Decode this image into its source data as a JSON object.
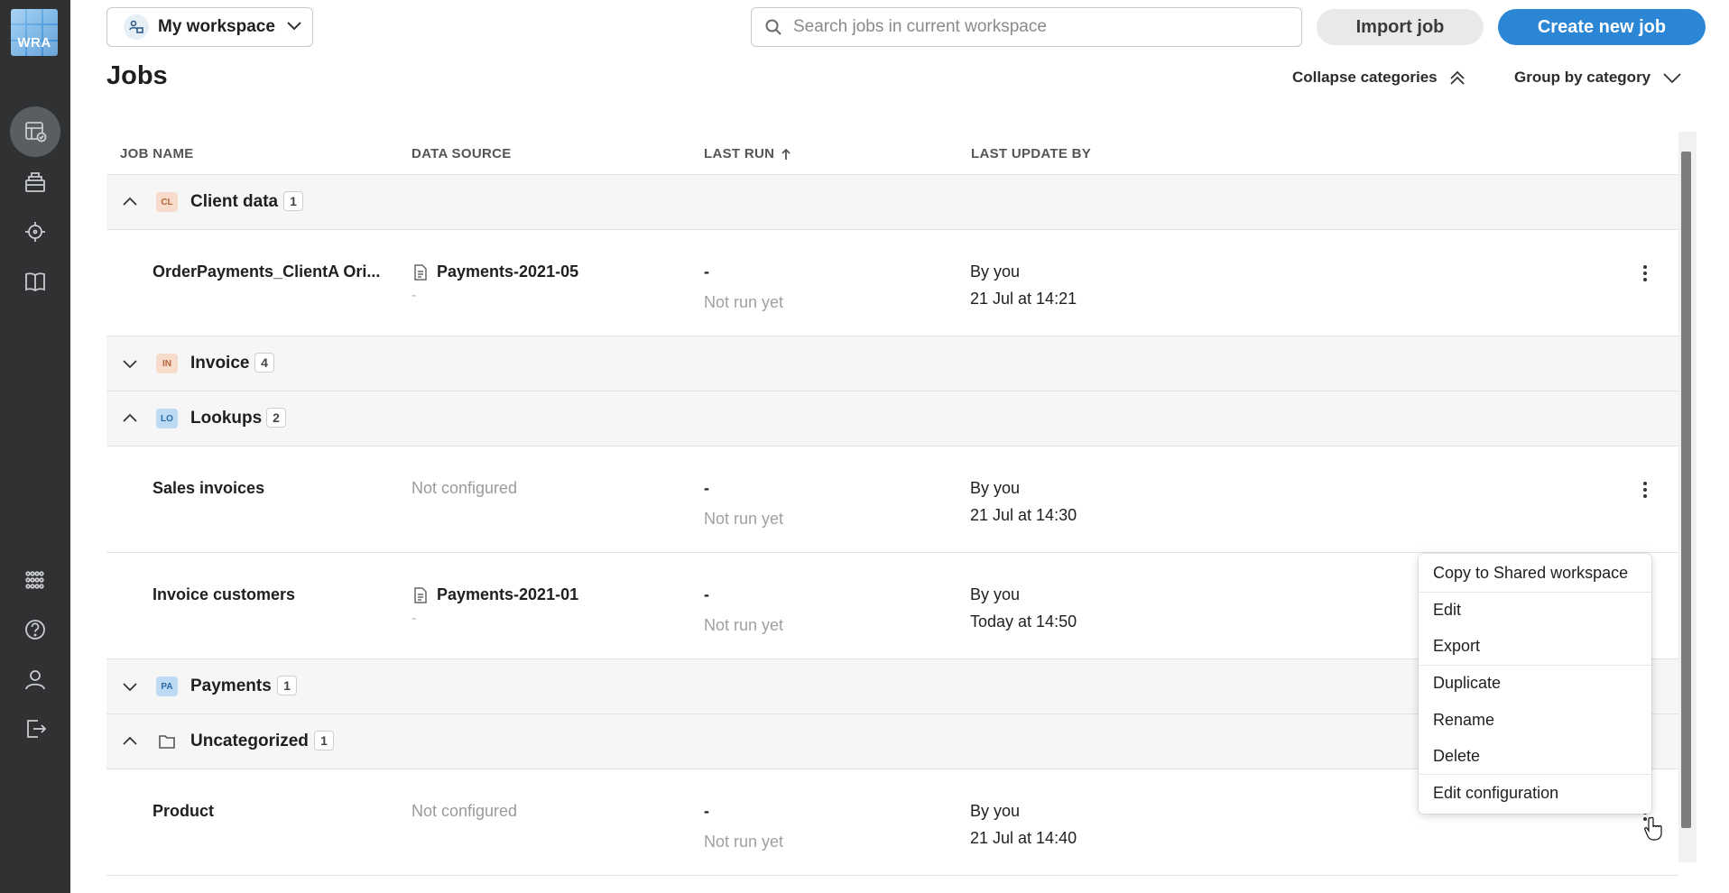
{
  "sidebar": {
    "logo_text": "WRA",
    "items": [
      {
        "name": "jobs-icon",
        "active": true
      },
      {
        "name": "data-sources-icon",
        "active": false
      },
      {
        "name": "target-icon",
        "active": false
      },
      {
        "name": "library-icon",
        "active": false
      },
      {
        "name": "apps-grid-icon",
        "active": false
      },
      {
        "name": "help-icon",
        "active": false
      },
      {
        "name": "user-icon",
        "active": false
      },
      {
        "name": "logout-icon",
        "active": false
      }
    ]
  },
  "header": {
    "workspace_label": "My workspace",
    "search_placeholder": "Search jobs in current workspace",
    "import_label": "Import job",
    "create_label": "Create new job",
    "accent_color": "#2b86d6"
  },
  "page": {
    "title": "Jobs",
    "collapse_label": "Collapse categories",
    "group_by_label": "Group by category"
  },
  "table": {
    "columns": [
      "JOB NAME",
      "DATA SOURCE",
      "LAST RUN",
      "LAST UPDATE BY"
    ],
    "categories": [
      {
        "badge": "CL",
        "name": "Client data",
        "count": "1",
        "expanded": true,
        "badge_bg": "#f7dccc",
        "badge_fg": "#b5643a",
        "jobs": [
          {
            "name": "OrderPayments_ClientA Ori...",
            "source": "Payments-2021-05",
            "source_sub": "-",
            "last_run": "-",
            "last_run_sub": "Not run yet",
            "updated_by": "By you",
            "updated_at": "21 Jul at 14:21"
          }
        ]
      },
      {
        "badge": "IN",
        "name": "Invoice",
        "count": "4",
        "expanded": false,
        "badge_bg": "#f7dccc",
        "badge_fg": "#b5643a",
        "jobs": []
      },
      {
        "badge": "LO",
        "name": "Lookups",
        "count": "2",
        "expanded": true,
        "badge_bg": "#bcdaf3",
        "badge_fg": "#2a6aa3",
        "jobs": [
          {
            "name": "Sales invoices",
            "source": "Not configured",
            "source_sub": "",
            "last_run": "-",
            "last_run_sub": "Not run yet",
            "updated_by": "By you",
            "updated_at": "21 Jul at 14:30"
          },
          {
            "name": "Invoice customers",
            "source": "Payments-2021-01",
            "source_sub": "-",
            "last_run": "-",
            "last_run_sub": "Not run yet",
            "updated_by": "By you",
            "updated_at": "Today at 14:50"
          }
        ]
      },
      {
        "badge": "PA",
        "name": "Payments",
        "count": "1",
        "expanded": false,
        "badge_bg": "#bcdaf3",
        "badge_fg": "#2a6aa3",
        "jobs": []
      },
      {
        "badge": "",
        "name": "Uncategorized",
        "count": "1",
        "expanded": true,
        "jobs": [
          {
            "name": "Product",
            "source": "Not configured",
            "source_sub": "",
            "last_run": "-",
            "last_run_sub": "Not run yet",
            "updated_by": "By you",
            "updated_at": "21 Jul at 14:40"
          }
        ]
      }
    ]
  },
  "context_menu": {
    "items": [
      "Copy to Shared workspace",
      "Edit",
      "Export",
      "Duplicate",
      "Rename",
      "Delete",
      "Edit configuration"
    ]
  }
}
